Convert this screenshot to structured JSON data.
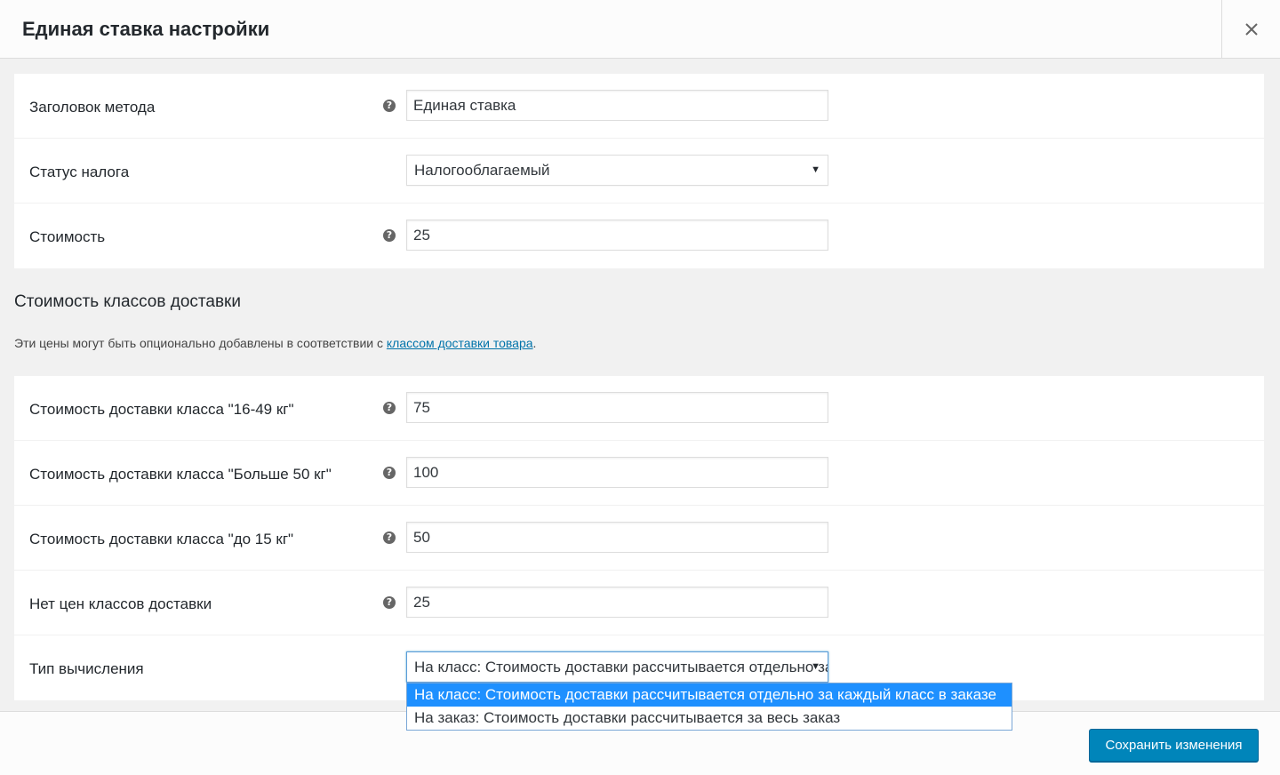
{
  "modal": {
    "title": "Единая ставка настройки",
    "close_glyph": "✕"
  },
  "fields": [
    {
      "label": "Заголовок метода",
      "value": "Единая ставка",
      "help": "?"
    },
    {
      "label": "Статус налога",
      "value": "Налогооблагаемый"
    },
    {
      "label": "Стоимость",
      "value": "25",
      "help": "?"
    }
  ],
  "shipping_classes": {
    "heading": "Стоимость классов доставки",
    "desc_prefix": "Эти цены могут быть опционально добавлены в соответствии с ",
    "desc_link": "классом доставки товара",
    "desc_suffix": ".",
    "rows": [
      {
        "label": "Стоимость доставки класса \"16-49 кг\"",
        "value": "75",
        "help": "?"
      },
      {
        "label": "Стоимость доставки класса \"Больше 50 кг\"",
        "value": "100",
        "help": "?"
      },
      {
        "label": "Стоимость доставки класса \"до 15 кг\"",
        "value": "50",
        "help": "?"
      },
      {
        "label": "Нет цен классов доставки",
        "value": "25",
        "help": "?"
      }
    ],
    "calc_type": {
      "label": "Тип вычисления",
      "value": "На класс: Стоимость доставки рассчитывается отдельно за каждый класс в заказе",
      "options": [
        "На класс: Стоимость доставки рассчитывается отдельно за каждый класс в заказе",
        "На заказ: Стоимость доставки рассчитывается за весь заказ"
      ]
    }
  },
  "select_arrow": "▼",
  "footer": {
    "save_label": "Сохранить изменения"
  },
  "colors": {
    "primary_button": "#0085ba",
    "link": "#0073aa",
    "dropdown_highlight": "#1e90ff"
  },
  "icons": {
    "close": "close-icon",
    "help": "help-icon",
    "select_arrow": "chevron-down-icon"
  }
}
